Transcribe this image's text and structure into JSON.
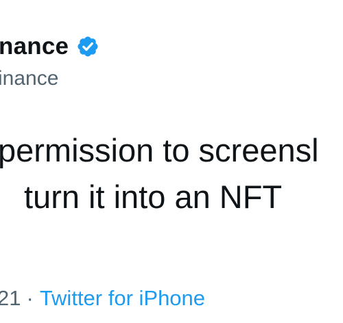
{
  "tweet": {
    "display_name": "nance",
    "verified_icon": "verified-badge-icon",
    "handle": "inance",
    "text_lines": [
      "permission to screensl",
      "turn it into an NFT"
    ],
    "date_partial": "21",
    "separator": "·",
    "source": "Twitter for iPhone"
  },
  "colors": {
    "primary_text": "#0f1419",
    "secondary_text": "#536471",
    "link": "#1d9bf0",
    "verified": "#1d9bf0"
  }
}
